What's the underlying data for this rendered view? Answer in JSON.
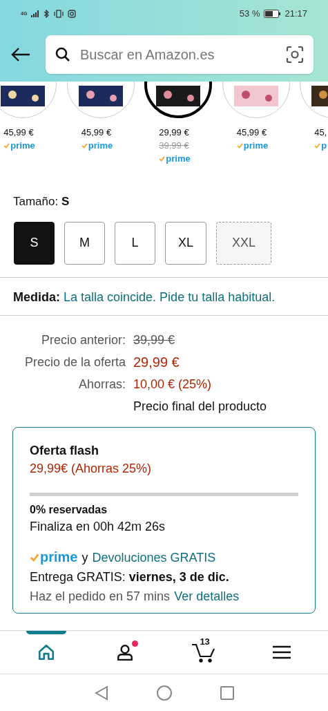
{
  "status_bar": {
    "network": "4G",
    "battery": "53 %",
    "time": "21:17"
  },
  "search": {
    "placeholder": "Buscar en Amazon.es"
  },
  "variants": [
    {
      "price": "45,99 €",
      "prime": "prime",
      "selected": false
    },
    {
      "price": "45,99 €",
      "prime": "prime",
      "selected": false
    },
    {
      "price": "29,99 €",
      "old_price": "39,99 €",
      "prime": "prime",
      "selected": true
    },
    {
      "price": "45,99 €",
      "prime": "prime",
      "selected": false
    },
    {
      "price": "45,",
      "prime": "p",
      "selected": false
    }
  ],
  "size": {
    "label": "Tamaño: ",
    "value": "S",
    "options": [
      {
        "label": "S",
        "selected": true,
        "disabled": false
      },
      {
        "label": "M",
        "selected": false,
        "disabled": false
      },
      {
        "label": "L",
        "selected": false,
        "disabled": false
      },
      {
        "label": "XL",
        "selected": false,
        "disabled": false
      },
      {
        "label": "XXL",
        "selected": false,
        "disabled": true
      }
    ]
  },
  "fit": {
    "label": "Medida:",
    "text": "La talla coincide. Pide tu talla habitual."
  },
  "prices": [
    {
      "label": "Precio anterior:",
      "value": "39,99 €",
      "kind": "struck"
    },
    {
      "label": "Precio de la oferta",
      "value": "29,99 €",
      "kind": "deal"
    },
    {
      "label": "Ahorras:",
      "value": "10,00 € (25%)",
      "kind": "saving"
    }
  ],
  "price_note": "Precio final del producto",
  "deal": {
    "title": "Oferta flash",
    "price": "29,99€ (Ahorras 25%)",
    "level": 0,
    "claimed": "0% reservadas",
    "ends": "Finaliza en 00h 42m 26s",
    "prime": "prime",
    "and": "y",
    "returns": "Devoluciones GRATIS",
    "delivery": "Entrega GRATIS: **viernes, 3 de dic.**",
    "order_within": "Haz el pedido en 57 mins",
    "details_link": "Ver detalles"
  },
  "bottom_nav": [
    {
      "kind": "home",
      "selected": true,
      "dot": false
    },
    {
      "kind": "account",
      "selected": false,
      "dot": true
    },
    {
      "kind": "cart",
      "selected": false,
      "badge": "13",
      "dot": false
    },
    {
      "kind": "menu",
      "selected": false,
      "dot": false
    }
  ]
}
